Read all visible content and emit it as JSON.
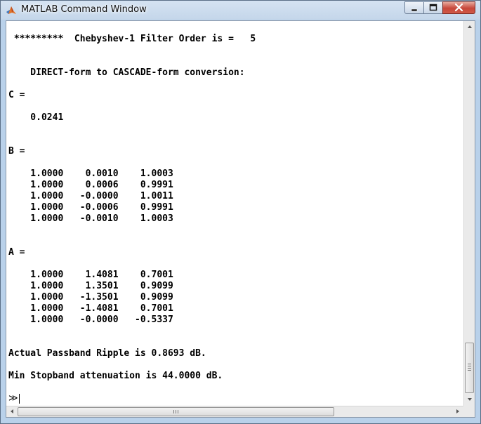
{
  "window": {
    "title": "MATLAB Command Window",
    "icon": "matlab-logo-icon",
    "controls": [
      "minimize-icon",
      "maximize-icon",
      "close-icon"
    ],
    "accent_color": "#b9d1ea",
    "close_color": "#c7473a"
  },
  "console": {
    "lines": [
      " *********  Chebyshev-1 Filter Order is =   5",
      "",
      "",
      "    DIRECT-form to CASCADE-form conversion:",
      "",
      "C =",
      "",
      "    0.0241",
      "",
      "",
      "B =",
      "",
      "    1.0000    0.0010    1.0003",
      "    1.0000    0.0006    0.9991",
      "    1.0000   -0.0000    1.0011",
      "    1.0000   -0.0006    0.9991",
      "    1.0000   -0.0010    1.0003",
      "",
      "",
      "A =",
      "",
      "    1.0000    1.4081    0.7001",
      "    1.0000    1.3501    0.9099",
      "    1.0000   -1.3501    0.9099",
      "    1.0000   -1.4081    0.7001",
      "    1.0000   -0.0000   -0.5337",
      "",
      "",
      "Actual Passband Ripple is 0.8693 dB.",
      "",
      "Min Stopband attenuation is 44.0000 dB.",
      ""
    ],
    "prompt": "≫",
    "input_value": ""
  }
}
